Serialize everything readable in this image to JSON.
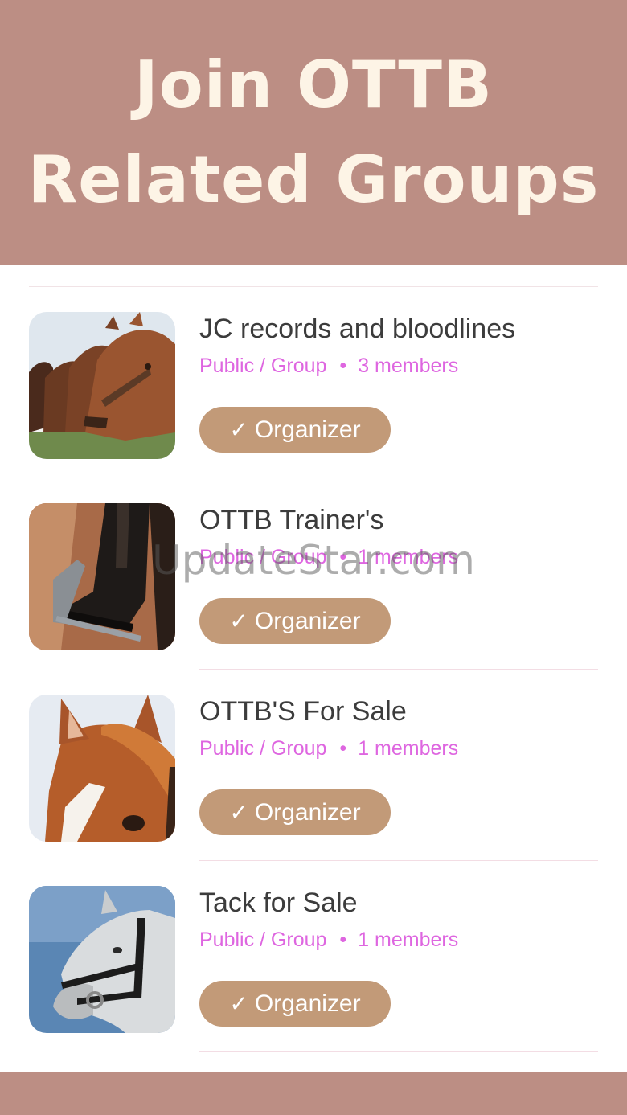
{
  "header": {
    "title_line1": "Join OTTB",
    "title_line2": "Related Groups"
  },
  "groups": [
    {
      "name": "JC records and bloodlines",
      "privacy": "Public / Group",
      "separator": "•",
      "members": "3 members",
      "check": "✓",
      "button_label": "Organizer",
      "image": "horses-at-fence-photo"
    },
    {
      "name": "OTTB Trainer's",
      "privacy": "Public / Group",
      "separator": "•",
      "members": "1 members",
      "check": "✓",
      "button_label": "Organizer",
      "image": "riding-boot-stirrup-photo"
    },
    {
      "name": "OTTB'S For Sale",
      "privacy": "Public / Group",
      "separator": "•",
      "members": "1 members",
      "check": "✓",
      "button_label": "Organizer",
      "image": "chestnut-horse-head-photo"
    },
    {
      "name": "Tack for Sale",
      "privacy": "Public / Group",
      "separator": "•",
      "members": "1 members",
      "check": "✓",
      "button_label": "Organizer",
      "image": "grey-horse-bridle-photo"
    }
  ],
  "watermark": "UpdateStar.com",
  "colors": {
    "header_bg": "#bc8e84",
    "title_text": "#fdf4e6",
    "meta_text": "#de66e0",
    "button_bg": "#c29a78"
  }
}
